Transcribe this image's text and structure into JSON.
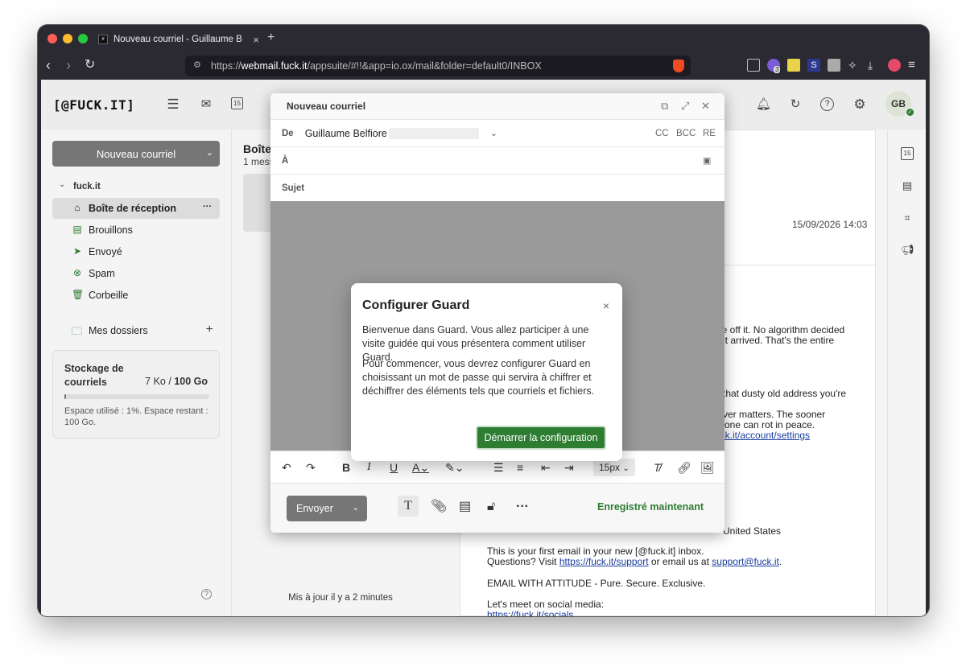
{
  "browser": {
    "tab_title": "Nouveau courriel - Guillaume B",
    "tab_close": "×",
    "new_tab": "+",
    "url_prefix": "https://",
    "url_host": "webmail.fuck.it",
    "url_path": "/appsuite/#!!&app=io.ox/mail&folder=default0/INBOX",
    "ext_badge": "3",
    "ext_s": "S"
  },
  "header": {
    "logo": "[@FUCK.IT]",
    "avatar_initials": "GB",
    "calendar_day": "15"
  },
  "sidebar": {
    "new_mail": "Nouveau courriel",
    "account": "fuck.it",
    "folders": [
      {
        "label": "Boîte de réception",
        "icon": "inbox-icon"
      },
      {
        "label": "Brouillons",
        "icon": "drafts-icon"
      },
      {
        "label": "Envoyé",
        "icon": "sent-icon"
      },
      {
        "label": "Spam",
        "icon": "spam-icon"
      },
      {
        "label": "Corbeille",
        "icon": "trash-icon"
      }
    ],
    "folder_more": "···",
    "my_folders": "Mes dossiers",
    "add": "+",
    "storage": {
      "title": "Stockage de courriels",
      "used": "7 Ko",
      "sep": " / ",
      "total": "100 Go",
      "used_fraction": 0.01,
      "info": "Espace utilisé : 1%. Espace restant : 100 Go."
    },
    "help": "?"
  },
  "list": {
    "title": "Boîte de réception",
    "count": "1 message",
    "updated": "Mis à jour il y a 2 minutes"
  },
  "detail": {
    "date": "15/09/2026 14:03",
    "lines": [
      "file off it. No algorithm decided",
      "d it arrived. That's the entire",
      "that dusty old address you're",
      "tever matters. The sooner",
      "one can rot in peace."
    ],
    "settings_link": "uck.it/account/settings",
    "address_tail": "United States",
    "first_email": "This is your first email in your new [@fuck.it] inbox.",
    "questions_prefix": "Questions? Visit",
    "support_link": "https://fuck.it/support",
    "questions_mid": "or email us at",
    "support_email": "support@fuck.it",
    "period": ".",
    "tagline": "EMAIL WITH ATTITUDE - Pure. Secure. Exclusive.",
    "social": "Let's meet on social media:",
    "social_link": "https://fuck.it/socials"
  },
  "compose": {
    "title": "Nouveau courriel",
    "from_label": "De",
    "from_value": "Guillaume Belfiore",
    "cc": "CC",
    "bcc": "BCC",
    "re": "RE",
    "to_label": "À",
    "subject_label": "Sujet",
    "font_size": "15px",
    "send": "Envoyer",
    "saved": "Enregistré maintenant"
  },
  "modal": {
    "title": "Configurer Guard",
    "close": "×",
    "p1": "Bienvenue dans Guard. Vous allez participer à une visite guidée qui vous présentera comment utiliser Guard.",
    "p2": "Pour commencer, vous devrez configurer Guard en choisissant un mot de passe qui servira à chiffrer et déchiffrer des éléments tels que courriels et fichiers.",
    "button": "Démarrer la configuration"
  }
}
